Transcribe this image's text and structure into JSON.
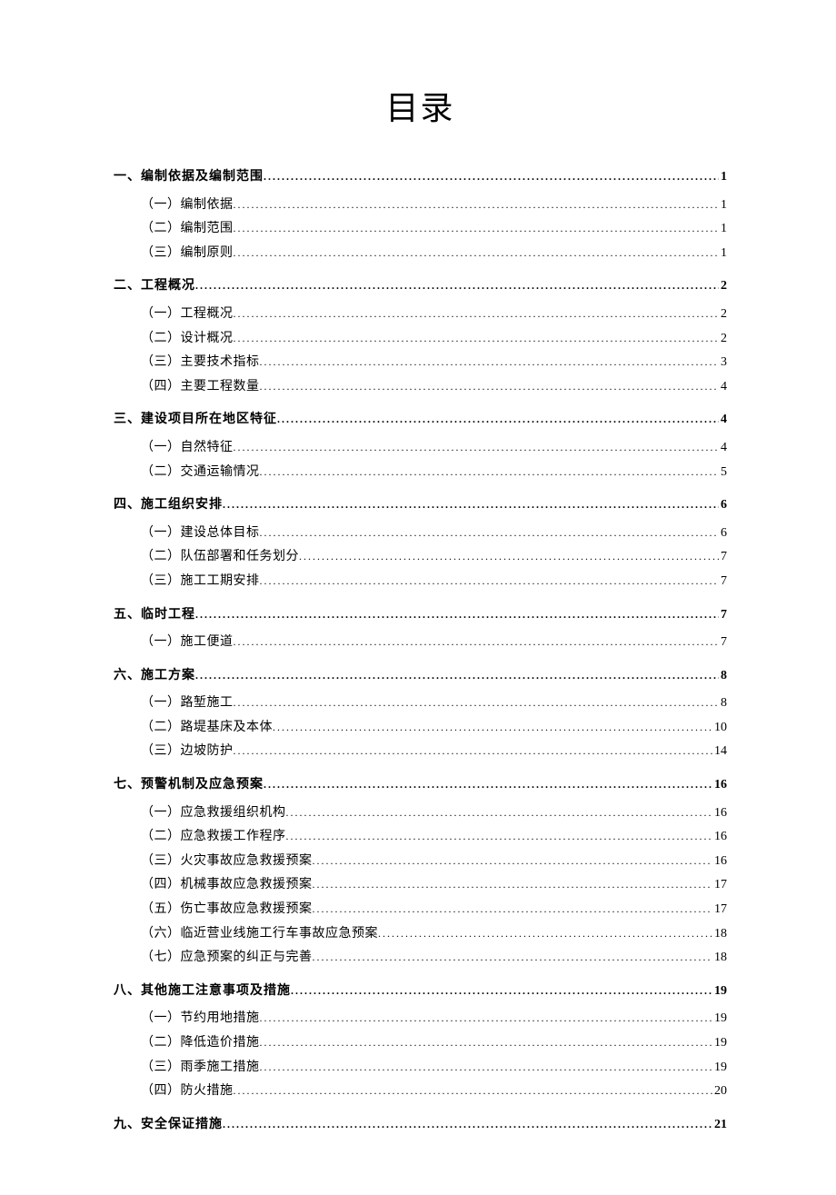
{
  "title": "目录",
  "toc": [
    {
      "level": 1,
      "label": "一、编制依据及编制范围",
      "page": "1"
    },
    {
      "level": 2,
      "label": "（一）编制依据",
      "page": "1"
    },
    {
      "level": 2,
      "label": "（二）编制范围",
      "page": "1"
    },
    {
      "level": 2,
      "label": "（三）编制原则",
      "page": "1"
    },
    {
      "level": 1,
      "label": "二、工程概况",
      "page": "2"
    },
    {
      "level": 2,
      "label": "（一）工程概况",
      "page": "2"
    },
    {
      "level": 2,
      "label": "（二）设计概况",
      "page": "2"
    },
    {
      "level": 2,
      "label": "（三）主要技术指标",
      "page": "3"
    },
    {
      "level": 2,
      "label": "（四）主要工程数量",
      "page": "4"
    },
    {
      "level": 1,
      "label": "三、建设项目所在地区特征",
      "page": "4"
    },
    {
      "level": 2,
      "label": "（一）自然特征",
      "page": "4"
    },
    {
      "level": 2,
      "label": "（二）交通运输情况",
      "page": "5"
    },
    {
      "level": 1,
      "label": "四、施工组织安排",
      "page": "6"
    },
    {
      "level": 2,
      "label": "（一）建设总体目标",
      "page": "6"
    },
    {
      "level": 2,
      "label": "（二）队伍部署和任务划分",
      "page": "7"
    },
    {
      "level": 2,
      "label": "（三）施工工期安排",
      "page": "7"
    },
    {
      "level": 1,
      "label": "五、临时工程",
      "page": "7"
    },
    {
      "level": 2,
      "label": "（一）施工便道",
      "page": "7"
    },
    {
      "level": 1,
      "label": "六、施工方案",
      "page": "8"
    },
    {
      "level": 2,
      "label": "（一）路堑施工",
      "page": "8"
    },
    {
      "level": 2,
      "label": "（二）路堤基床及本体",
      "page": "10"
    },
    {
      "level": 2,
      "label": "（三）边坡防护",
      "page": "14"
    },
    {
      "level": 1,
      "label": "七、预警机制及应急预案",
      "page": "16"
    },
    {
      "level": 2,
      "label": "（一）应急救援组织机构",
      "page": "16"
    },
    {
      "level": 2,
      "label": "（二）应急救援工作程序",
      "page": "16"
    },
    {
      "level": 2,
      "label": "（三）火灾事故应急救援预案",
      "page": "16"
    },
    {
      "level": 2,
      "label": "（四）机械事故应急救援预案",
      "page": "17"
    },
    {
      "level": 2,
      "label": "（五）伤亡事故应急救援预案",
      "page": "17"
    },
    {
      "level": 2,
      "label": "（六）临近营业线施工行车事故应急预案",
      "page": "18"
    },
    {
      "level": 2,
      "label": "（七）应急预案的纠正与完善",
      "page": "18"
    },
    {
      "level": 1,
      "label": "八、其他施工注意事项及措施",
      "page": "19"
    },
    {
      "level": 2,
      "label": "（一）节约用地措施",
      "page": "19"
    },
    {
      "level": 2,
      "label": "（二）降低造价措施",
      "page": "19"
    },
    {
      "level": 2,
      "label": "（三）雨季施工措施",
      "page": "19"
    },
    {
      "level": 2,
      "label": "（四）防火措施",
      "page": "20"
    },
    {
      "level": 1,
      "label": "九、安全保证措施",
      "page": "21"
    }
  ]
}
